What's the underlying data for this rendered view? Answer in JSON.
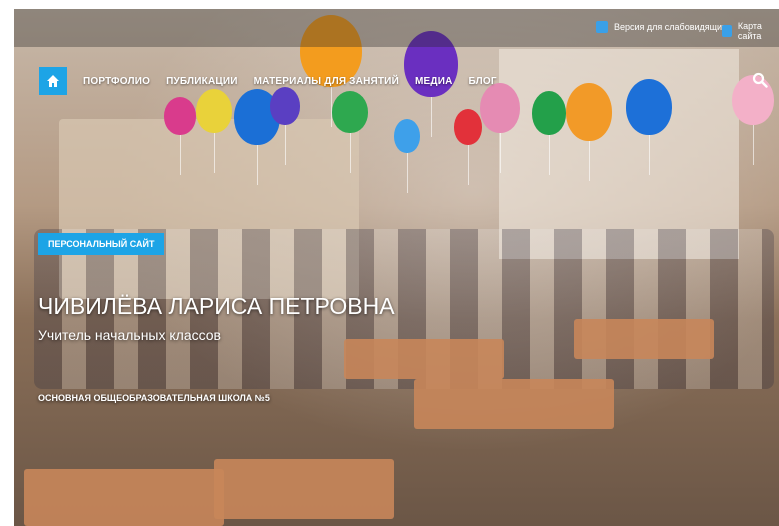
{
  "topbar": {
    "low_vision_label": "Версия для слабовидящих",
    "sitemap_label": "Карта сайта"
  },
  "nav": {
    "home_icon": "home-icon",
    "items": [
      {
        "label": "ПОРТФОЛИО"
      },
      {
        "label": "ПУБЛИКАЦИИ"
      },
      {
        "label": "МАТЕРИАЛЫ ДЛЯ ЗАНЯТИЙ"
      },
      {
        "label": "МЕДИА"
      },
      {
        "label": "БЛОГ"
      }
    ],
    "search_icon": "search-icon"
  },
  "hero": {
    "tag": "ПЕРСОНАЛЬНЫЙ САЙТ",
    "name": "ЧИВИЛЁВА ЛАРИСА ПЕТРОВНА",
    "role": "Учитель начальных классов",
    "school": "ОСНОВНАЯ ОБЩЕОБРАЗОВАТЕЛЬНАЯ ШКОЛА №5"
  },
  "colors": {
    "accent": "#1da4e6"
  }
}
